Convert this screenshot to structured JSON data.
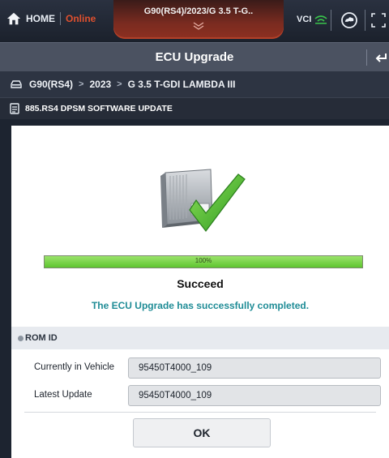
{
  "topbar": {
    "home_label": "HOME",
    "online_label": "Online",
    "vehicle_title": "G90(RS4)/2023/G 3.5 T-G..",
    "vci_label": "VCI",
    "icons": [
      "home-icon",
      "chevron-down-icon",
      "wifi-icon",
      "cloud-icon",
      "screen-capture-icon"
    ],
    "colors": {
      "online": "#e0502e",
      "vci_wifi": "#39c24b"
    }
  },
  "titlebar": {
    "title": "ECU Upgrade",
    "back_icon": "back-arrow-icon"
  },
  "breadcrumb": {
    "items": [
      "G90(RS4)",
      "2023",
      "G 3.5 T-GDI LAMBDA III"
    ],
    "separator": ">"
  },
  "subheader": {
    "title": "885.RS4 DPSM SOFTWARE UPDATE"
  },
  "result": {
    "progress_label": "100%",
    "progress_value": 1.0,
    "status": "Succeed",
    "message": "The ECU Upgrade has successfully completed.",
    "colors": {
      "progress": "#5ec52f",
      "message": "#1f8c96"
    }
  },
  "rom": {
    "header": "ROM ID",
    "rows": [
      {
        "label": "Currently in Vehicle",
        "value": "95450T4000_109"
      },
      {
        "label": "Latest Update",
        "value": "95450T4000_109"
      }
    ]
  },
  "actions": {
    "ok_label": "OK"
  }
}
